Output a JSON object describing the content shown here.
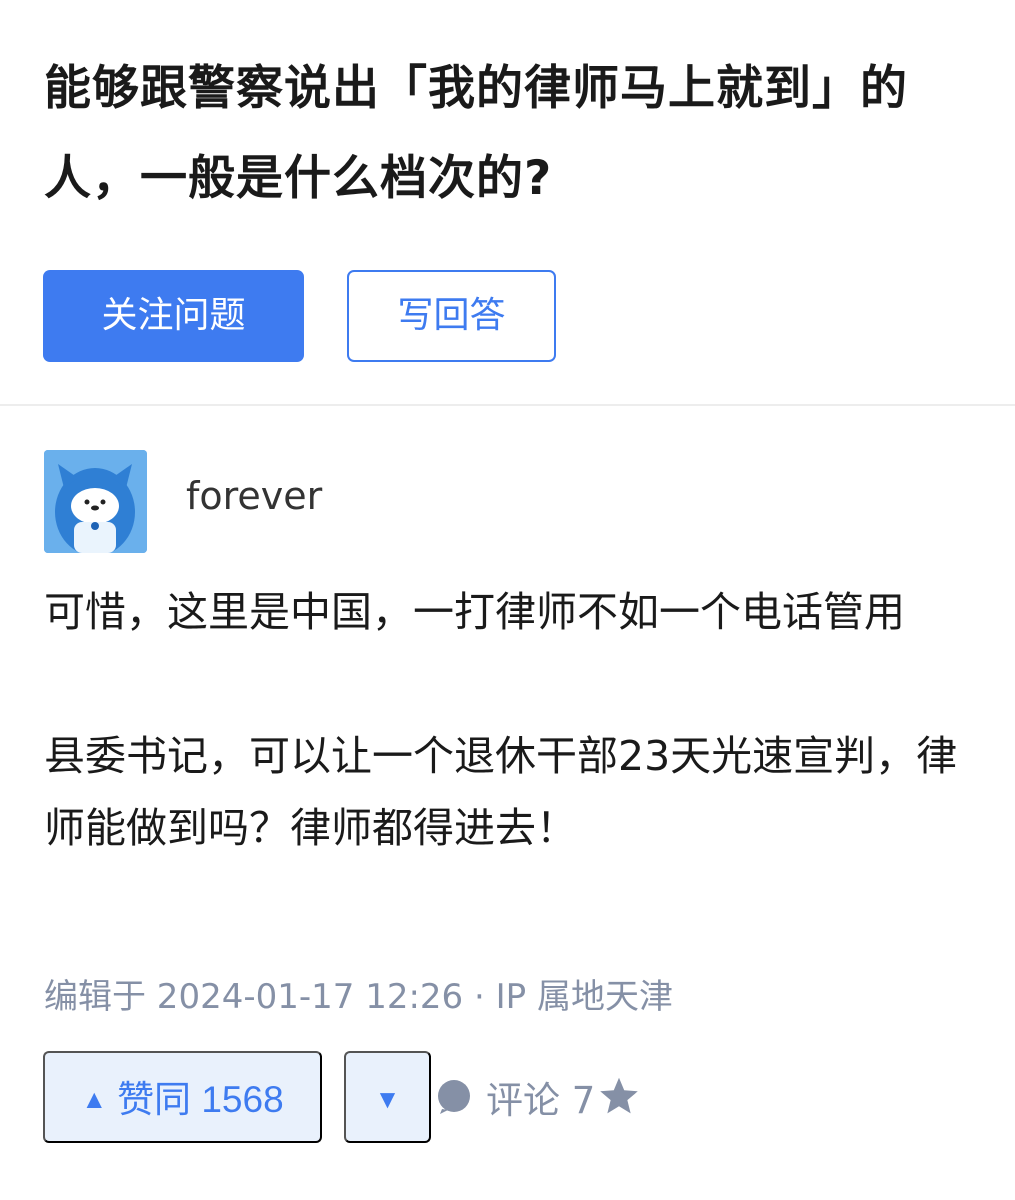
{
  "question": {
    "title": "能够跟警察说出「我的律师马上就到」的人，一般是什么档次的?",
    "follow_label": "关注问题",
    "write_answer_label": "写回答"
  },
  "answer": {
    "author": "forever",
    "body": "可惜，这里是中国，一打律师不如一个电话管用\n\n县委书记，可以让一个退休干部23天光速宣判，律师能做到吗？律师都得进去！",
    "meta": "编辑于 2024-01-17 12:26 · IP 属地天津",
    "upvote_label": "赞同 1568",
    "comment_label": "评论 7"
  },
  "icons": {
    "upvote": "triangle-up-icon",
    "downvote": "triangle-down-icon",
    "comment": "speech-bubble-icon",
    "favorite": "star-icon"
  },
  "colors": {
    "accent": "#3e7bf0",
    "vote_bg": "#e9f1fc",
    "meta_text": "#8590a6"
  }
}
